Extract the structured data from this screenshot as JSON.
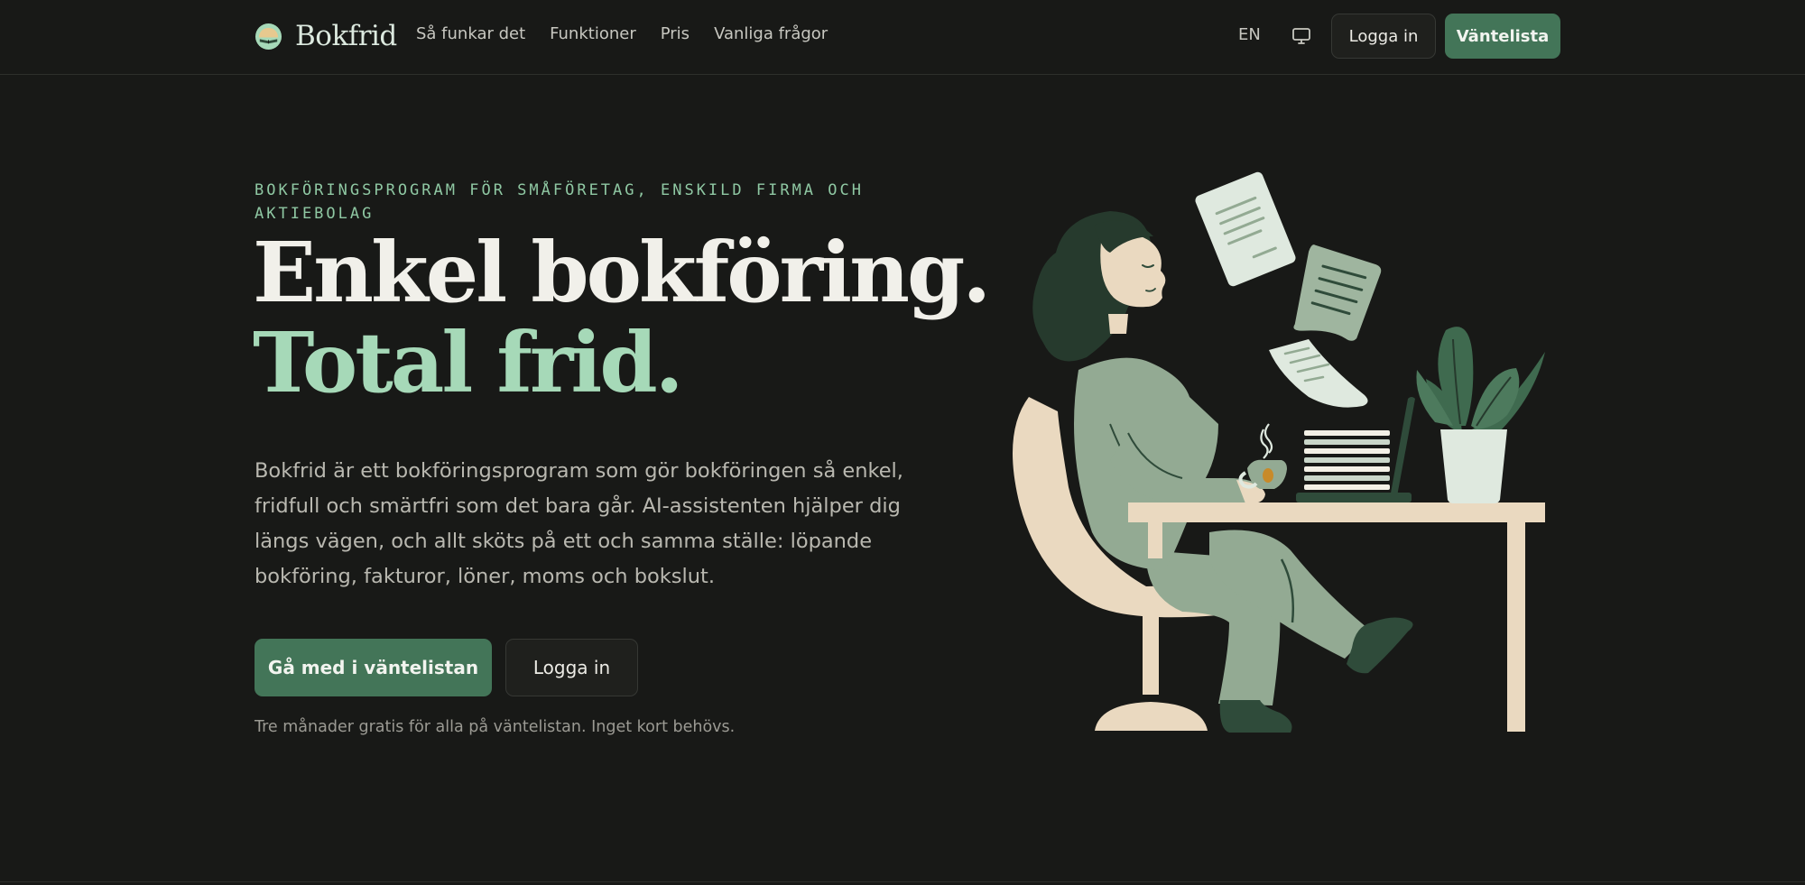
{
  "brand": {
    "name": "Bokfrid",
    "logo_icon": "book-sunrise-logo"
  },
  "nav": {
    "items": [
      {
        "label": "Så funkar det"
      },
      {
        "label": "Funktioner"
      },
      {
        "label": "Pris"
      },
      {
        "label": "Vanliga frågor"
      }
    ]
  },
  "header": {
    "language": "EN",
    "display_icon": "monitor-icon",
    "login_label": "Logga in",
    "waitlist_label": "Väntelista"
  },
  "hero": {
    "eyebrow": "Bokföringsprogram för småföretag, enskild firma och aktiebolag",
    "headline_line1": "Enkel bokföring.",
    "headline_line2": "Total frid.",
    "lead": "Bokfrid är ett bokföringsprogram som gör bokföringen så enkel, fridfull och smärtfri som det bara går. AI-assistenten hjälper dig längs vägen, och allt sköts på ett och samma ställe: löpande bokföring, fakturor, löner, moms och bokslut.",
    "primary_cta": "Gå med i väntelistan",
    "secondary_cta": "Logga in",
    "note": "Tre månader gratis för alla på väntelistan. Inget kort behövs.",
    "illustration": "relaxed-woman-at-desk-illustration"
  },
  "colors": {
    "background": "#181917",
    "accent_green": "#437558",
    "light_green": "#a6d9b8",
    "eyebrow_green": "#8fc8a3",
    "text_primary": "#f1f0ea",
    "text_muted": "#b9b8b0",
    "cream": "#ead9c0",
    "sage": "#93aa93",
    "dark_green": "#2f4b3a"
  }
}
